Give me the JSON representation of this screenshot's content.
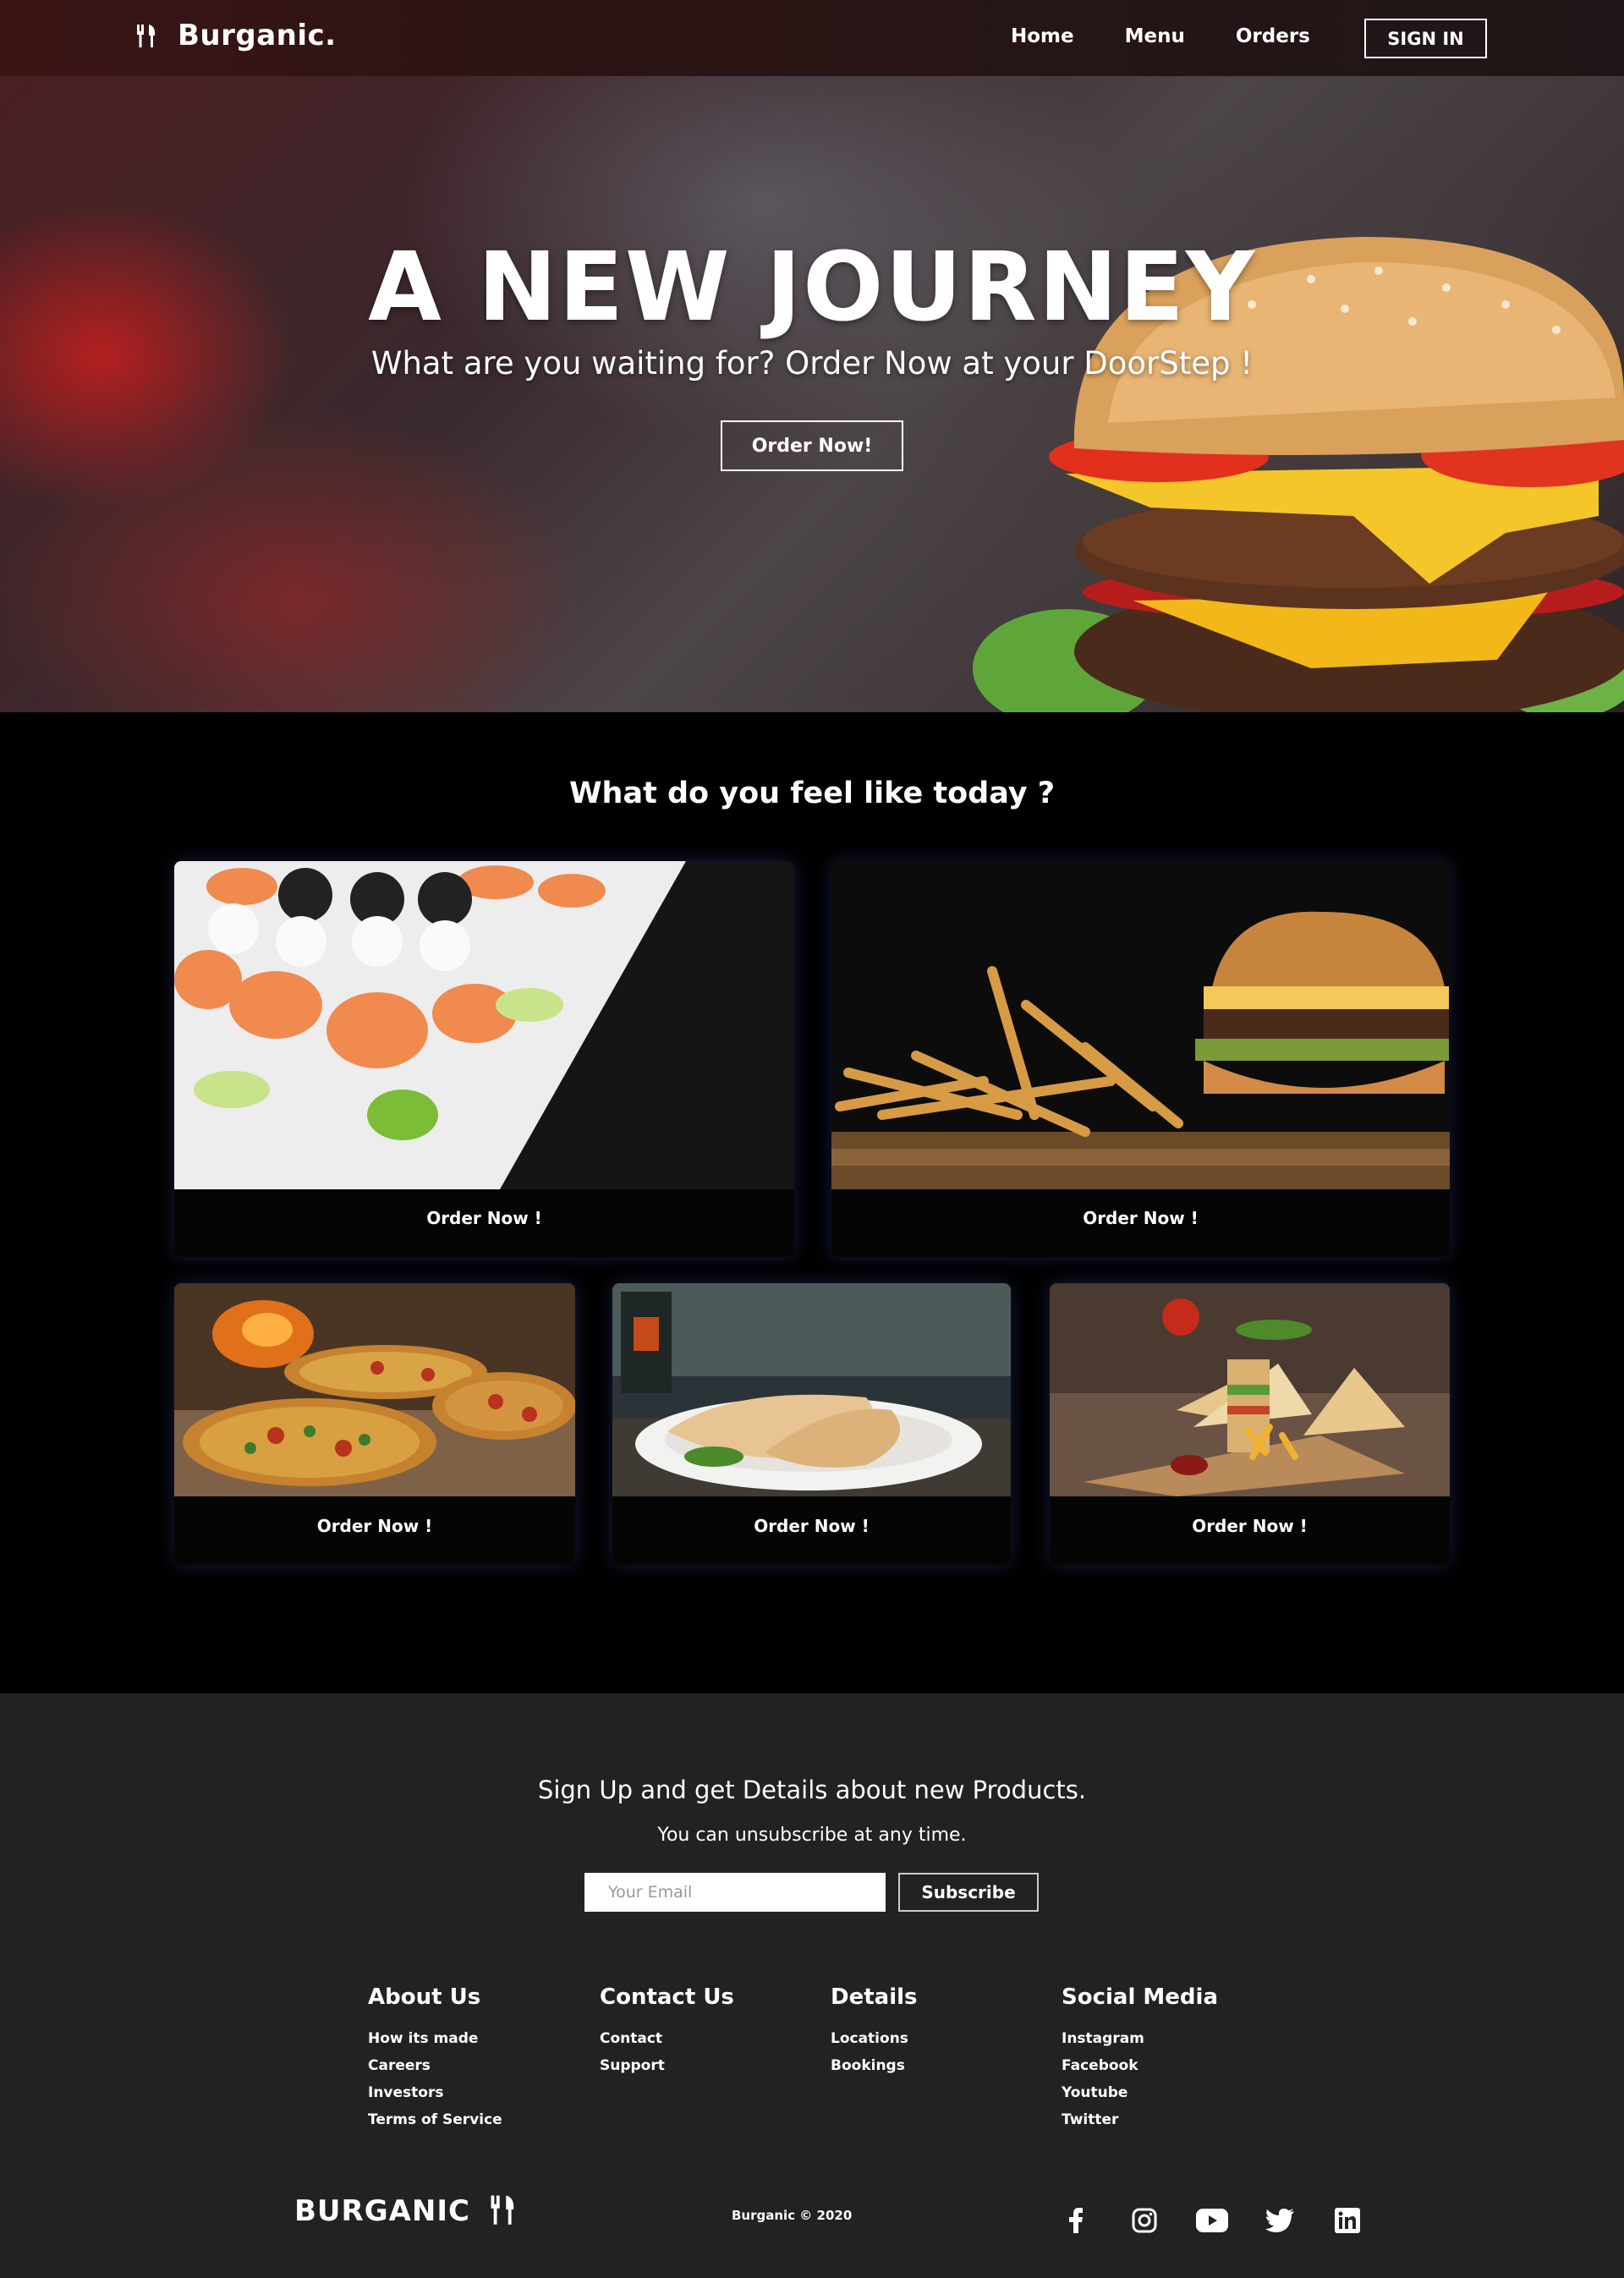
{
  "nav": {
    "brand": "Burganic.",
    "links": [
      "Home",
      "Menu",
      "Orders"
    ],
    "signin_label": "SIGN IN"
  },
  "hero": {
    "title": "A NEW JOURNEY",
    "subtitle": "What are you waiting for? Order Now at your DoorStep !",
    "button_label": "Order Now!"
  },
  "menu_section": {
    "title": "What do you feel like today ?",
    "cards": [
      {
        "label": "Order Now !",
        "image": "sushi-platter"
      },
      {
        "label": "Order Now !",
        "image": "burger-and-fries"
      },
      {
        "label": "Order Now !",
        "image": "pizzas"
      },
      {
        "label": "Order Now !",
        "image": "wraps"
      },
      {
        "label": "Order Now !",
        "image": "club-sandwiches"
      }
    ]
  },
  "footer": {
    "signup_title": "Sign Up and get Details about new Products.",
    "signup_subtitle": "You can unsubscribe at any time.",
    "email_placeholder": "Your Email",
    "subscribe_label": "Subscribe",
    "columns": [
      {
        "title": "About Us",
        "links": [
          "How its made",
          "Careers",
          "Investors",
          "Terms of Service"
        ]
      },
      {
        "title": "Contact Us",
        "links": [
          "Contact",
          "Support"
        ]
      },
      {
        "title": "Details",
        "links": [
          "Locations",
          "Bookings"
        ]
      },
      {
        "title": "Social Media",
        "links": [
          "Instagram",
          "Facebook",
          "Youtube",
          "Twitter"
        ]
      }
    ],
    "brand": "BURGANIC",
    "copyright": "Burganic © 2020",
    "social_icons": [
      "facebook-icon",
      "instagram-icon",
      "youtube-icon",
      "twitter-icon",
      "linkedin-icon"
    ]
  },
  "colors": {
    "nav_bg": "#2b1414",
    "page_bg": "#000000",
    "footer_bg": "#222222",
    "card_glow": "#28326e"
  }
}
